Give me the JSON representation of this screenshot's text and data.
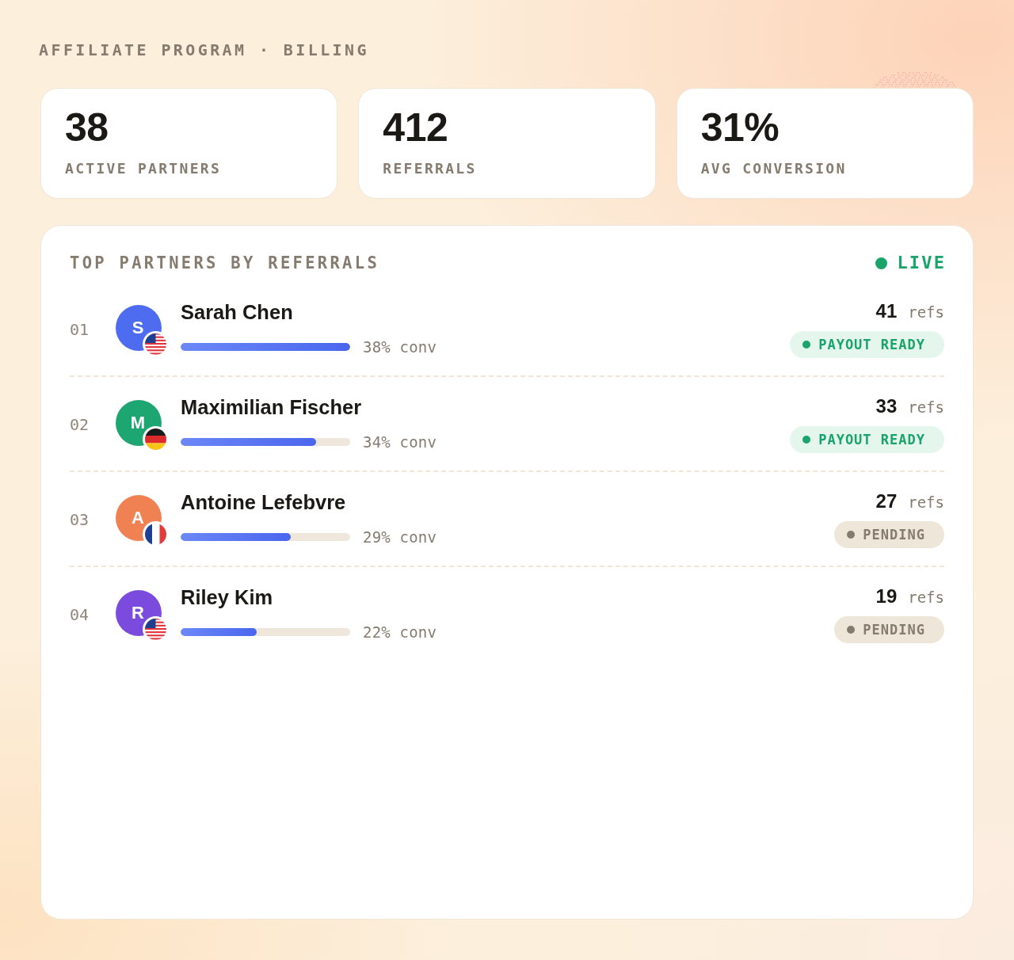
{
  "header": {
    "title": "AFFILIATE PROGRAM · BILLING"
  },
  "stats": [
    {
      "value": "38",
      "label": "ACTIVE PARTNERS"
    },
    {
      "value": "412",
      "label": "REFERRALS"
    },
    {
      "value": "31%",
      "label": "AVG CONVERSION"
    }
  ],
  "leaderboard": {
    "title": "TOP PARTNERS BY REFERRALS",
    "live": {
      "label": "LIVE"
    },
    "partners": [
      {
        "rank": "01",
        "initial": "S",
        "color": "#4d6cf0",
        "flag": {
          "kind": "us"
        },
        "name": "Sarah Chen",
        "level": 1.0,
        "conversion": "38% conv",
        "refs": "41",
        "refs_unit": "refs",
        "status": {
          "kind": "ready",
          "label": "PAYOUT READY"
        }
      },
      {
        "rank": "02",
        "initial": "M",
        "color": "#1ea672",
        "flag": {
          "kind": "de"
        },
        "name": "Maximilian Fischer",
        "level": 0.8,
        "conversion": "34% conv",
        "refs": "33",
        "refs_unit": "refs",
        "status": {
          "kind": "ready",
          "label": "PAYOUT READY"
        }
      },
      {
        "rank": "03",
        "initial": "A",
        "color": "#f08152",
        "flag": {
          "kind": "fr"
        },
        "name": "Antoine Lefebvre",
        "level": 0.65,
        "conversion": "29% conv",
        "refs": "27",
        "refs_unit": "refs",
        "status": {
          "kind": "pending",
          "label": "PENDING"
        }
      },
      {
        "rank": "04",
        "initial": "R",
        "color": "#7a4bdc",
        "flag": {
          "kind": "us"
        },
        "name": "Riley Kim",
        "level": 0.45,
        "conversion": "22% conv",
        "refs": "19",
        "refs_unit": "refs",
        "status": {
          "kind": "pending",
          "label": "PENDING"
        }
      }
    ]
  }
}
